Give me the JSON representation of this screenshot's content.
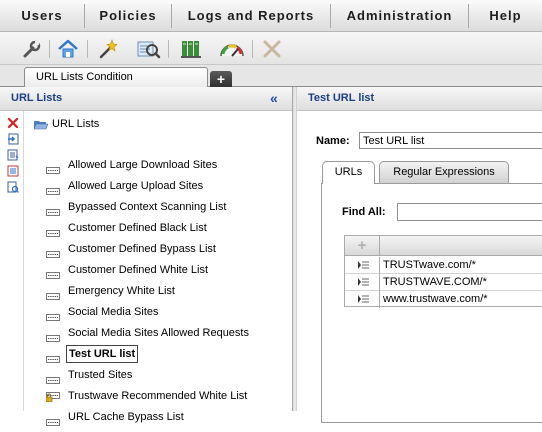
{
  "menu": {
    "items": [
      "Users",
      "Policies",
      "Logs and Reports",
      "Administration",
      "Help"
    ]
  },
  "toolbar": {
    "icons": [
      "wrench-icon",
      "home-icon",
      "wand-icon",
      "search-icon",
      "books-icon",
      "gauge-icon",
      "tools-icon"
    ]
  },
  "tabs": {
    "doc_tab_label": "URL Lists Condition",
    "add_tab_label": "+"
  },
  "left_panel": {
    "title": "URL Lists",
    "collapse_glyph": "«",
    "root_label": "URL Lists",
    "items": [
      {
        "label": "Allowed Large Download Sites",
        "locked": false,
        "selected": false
      },
      {
        "label": "Allowed Large Upload Sites",
        "locked": false,
        "selected": false
      },
      {
        "label": "Bypassed Context Scanning List",
        "locked": false,
        "selected": false
      },
      {
        "label": "Customer Defined Black List",
        "locked": false,
        "selected": false
      },
      {
        "label": "Customer Defined Bypass List",
        "locked": false,
        "selected": false
      },
      {
        "label": "Customer Defined White List",
        "locked": false,
        "selected": false
      },
      {
        "label": "Emergency White List",
        "locked": false,
        "selected": false
      },
      {
        "label": "Social Media Sites",
        "locked": false,
        "selected": false
      },
      {
        "label": "Social Media Sites Allowed Requests",
        "locked": false,
        "selected": false
      },
      {
        "label": "Test URL list",
        "locked": false,
        "selected": true
      },
      {
        "label": "Trusted Sites",
        "locked": false,
        "selected": false
      },
      {
        "label": "Trustwave Recommended White List",
        "locked": true,
        "selected": false
      },
      {
        "label": "URL Cache Bypass List",
        "locked": false,
        "selected": false
      }
    ]
  },
  "right_panel": {
    "title": "Test URL list",
    "name_label": "Name:",
    "name_value": "Test URL list",
    "tabs": [
      "URLs",
      "Regular Expressions"
    ],
    "active_tab": "URLs",
    "find_all_label": "Find All:",
    "find_all_value": "",
    "grid_add_glyph": "+",
    "urls": [
      "TRUSTwave.com/*",
      "TRUSTWAVE.COM/*",
      "www.trustwave.com/*"
    ]
  }
}
